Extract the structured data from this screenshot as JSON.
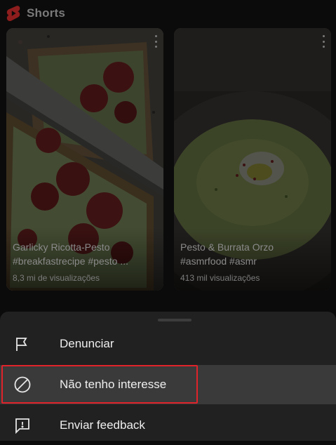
{
  "header": {
    "title": "Shorts",
    "logo_icon": "youtube-shorts-icon",
    "accent_color": "#8e1d1d"
  },
  "cards": [
    {
      "title": "Garlicky Ricotta-Pesto\n#breakfastrecipe #pesto ...",
      "views": "8,3 mi de visualizações"
    },
    {
      "title": "Pesto & Burrata Orzo\n#asmrfood #asmr",
      "views": "413 mil visualizações"
    }
  ],
  "menu": {
    "items": [
      {
        "label": "Denunciar",
        "icon": "flag-icon"
      },
      {
        "label": "Não tenho interesse",
        "icon": "block-icon"
      },
      {
        "label": "Enviar feedback",
        "icon": "feedback-icon"
      }
    ],
    "highlight_color": "#e0232b"
  }
}
